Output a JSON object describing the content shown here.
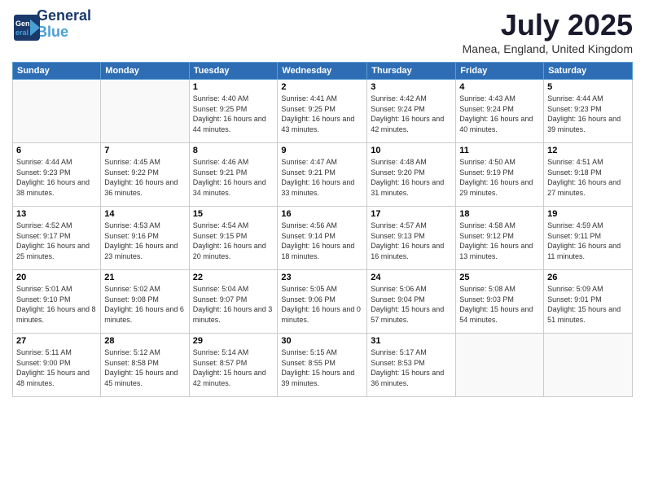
{
  "header": {
    "logo_line1": "General",
    "logo_line2": "Blue",
    "month_title": "July 2025",
    "location": "Manea, England, United Kingdom"
  },
  "weekdays": [
    "Sunday",
    "Monday",
    "Tuesday",
    "Wednesday",
    "Thursday",
    "Friday",
    "Saturday"
  ],
  "weeks": [
    [
      {
        "day": "",
        "sunrise": "",
        "sunset": "",
        "daylight": ""
      },
      {
        "day": "",
        "sunrise": "",
        "sunset": "",
        "daylight": ""
      },
      {
        "day": "1",
        "sunrise": "Sunrise: 4:40 AM",
        "sunset": "Sunset: 9:25 PM",
        "daylight": "Daylight: 16 hours and 44 minutes."
      },
      {
        "day": "2",
        "sunrise": "Sunrise: 4:41 AM",
        "sunset": "Sunset: 9:25 PM",
        "daylight": "Daylight: 16 hours and 43 minutes."
      },
      {
        "day": "3",
        "sunrise": "Sunrise: 4:42 AM",
        "sunset": "Sunset: 9:24 PM",
        "daylight": "Daylight: 16 hours and 42 minutes."
      },
      {
        "day": "4",
        "sunrise": "Sunrise: 4:43 AM",
        "sunset": "Sunset: 9:24 PM",
        "daylight": "Daylight: 16 hours and 40 minutes."
      },
      {
        "day": "5",
        "sunrise": "Sunrise: 4:44 AM",
        "sunset": "Sunset: 9:23 PM",
        "daylight": "Daylight: 16 hours and 39 minutes."
      }
    ],
    [
      {
        "day": "6",
        "sunrise": "Sunrise: 4:44 AM",
        "sunset": "Sunset: 9:23 PM",
        "daylight": "Daylight: 16 hours and 38 minutes."
      },
      {
        "day": "7",
        "sunrise": "Sunrise: 4:45 AM",
        "sunset": "Sunset: 9:22 PM",
        "daylight": "Daylight: 16 hours and 36 minutes."
      },
      {
        "day": "8",
        "sunrise": "Sunrise: 4:46 AM",
        "sunset": "Sunset: 9:21 PM",
        "daylight": "Daylight: 16 hours and 34 minutes."
      },
      {
        "day": "9",
        "sunrise": "Sunrise: 4:47 AM",
        "sunset": "Sunset: 9:21 PM",
        "daylight": "Daylight: 16 hours and 33 minutes."
      },
      {
        "day": "10",
        "sunrise": "Sunrise: 4:48 AM",
        "sunset": "Sunset: 9:20 PM",
        "daylight": "Daylight: 16 hours and 31 minutes."
      },
      {
        "day": "11",
        "sunrise": "Sunrise: 4:50 AM",
        "sunset": "Sunset: 9:19 PM",
        "daylight": "Daylight: 16 hours and 29 minutes."
      },
      {
        "day": "12",
        "sunrise": "Sunrise: 4:51 AM",
        "sunset": "Sunset: 9:18 PM",
        "daylight": "Daylight: 16 hours and 27 minutes."
      }
    ],
    [
      {
        "day": "13",
        "sunrise": "Sunrise: 4:52 AM",
        "sunset": "Sunset: 9:17 PM",
        "daylight": "Daylight: 16 hours and 25 minutes."
      },
      {
        "day": "14",
        "sunrise": "Sunrise: 4:53 AM",
        "sunset": "Sunset: 9:16 PM",
        "daylight": "Daylight: 16 hours and 23 minutes."
      },
      {
        "day": "15",
        "sunrise": "Sunrise: 4:54 AM",
        "sunset": "Sunset: 9:15 PM",
        "daylight": "Daylight: 16 hours and 20 minutes."
      },
      {
        "day": "16",
        "sunrise": "Sunrise: 4:56 AM",
        "sunset": "Sunset: 9:14 PM",
        "daylight": "Daylight: 16 hours and 18 minutes."
      },
      {
        "day": "17",
        "sunrise": "Sunrise: 4:57 AM",
        "sunset": "Sunset: 9:13 PM",
        "daylight": "Daylight: 16 hours and 16 minutes."
      },
      {
        "day": "18",
        "sunrise": "Sunrise: 4:58 AM",
        "sunset": "Sunset: 9:12 PM",
        "daylight": "Daylight: 16 hours and 13 minutes."
      },
      {
        "day": "19",
        "sunrise": "Sunrise: 4:59 AM",
        "sunset": "Sunset: 9:11 PM",
        "daylight": "Daylight: 16 hours and 11 minutes."
      }
    ],
    [
      {
        "day": "20",
        "sunrise": "Sunrise: 5:01 AM",
        "sunset": "Sunset: 9:10 PM",
        "daylight": "Daylight: 16 hours and 8 minutes."
      },
      {
        "day": "21",
        "sunrise": "Sunrise: 5:02 AM",
        "sunset": "Sunset: 9:08 PM",
        "daylight": "Daylight: 16 hours and 6 minutes."
      },
      {
        "day": "22",
        "sunrise": "Sunrise: 5:04 AM",
        "sunset": "Sunset: 9:07 PM",
        "daylight": "Daylight: 16 hours and 3 minutes."
      },
      {
        "day": "23",
        "sunrise": "Sunrise: 5:05 AM",
        "sunset": "Sunset: 9:06 PM",
        "daylight": "Daylight: 16 hours and 0 minutes."
      },
      {
        "day": "24",
        "sunrise": "Sunrise: 5:06 AM",
        "sunset": "Sunset: 9:04 PM",
        "daylight": "Daylight: 15 hours and 57 minutes."
      },
      {
        "day": "25",
        "sunrise": "Sunrise: 5:08 AM",
        "sunset": "Sunset: 9:03 PM",
        "daylight": "Daylight: 15 hours and 54 minutes."
      },
      {
        "day": "26",
        "sunrise": "Sunrise: 5:09 AM",
        "sunset": "Sunset: 9:01 PM",
        "daylight": "Daylight: 15 hours and 51 minutes."
      }
    ],
    [
      {
        "day": "27",
        "sunrise": "Sunrise: 5:11 AM",
        "sunset": "Sunset: 9:00 PM",
        "daylight": "Daylight: 15 hours and 48 minutes."
      },
      {
        "day": "28",
        "sunrise": "Sunrise: 5:12 AM",
        "sunset": "Sunset: 8:58 PM",
        "daylight": "Daylight: 15 hours and 45 minutes."
      },
      {
        "day": "29",
        "sunrise": "Sunrise: 5:14 AM",
        "sunset": "Sunset: 8:57 PM",
        "daylight": "Daylight: 15 hours and 42 minutes."
      },
      {
        "day": "30",
        "sunrise": "Sunrise: 5:15 AM",
        "sunset": "Sunset: 8:55 PM",
        "daylight": "Daylight: 15 hours and 39 minutes."
      },
      {
        "day": "31",
        "sunrise": "Sunrise: 5:17 AM",
        "sunset": "Sunset: 8:53 PM",
        "daylight": "Daylight: 15 hours and 36 minutes."
      },
      {
        "day": "",
        "sunrise": "",
        "sunset": "",
        "daylight": ""
      },
      {
        "day": "",
        "sunrise": "",
        "sunset": "",
        "daylight": ""
      }
    ]
  ]
}
